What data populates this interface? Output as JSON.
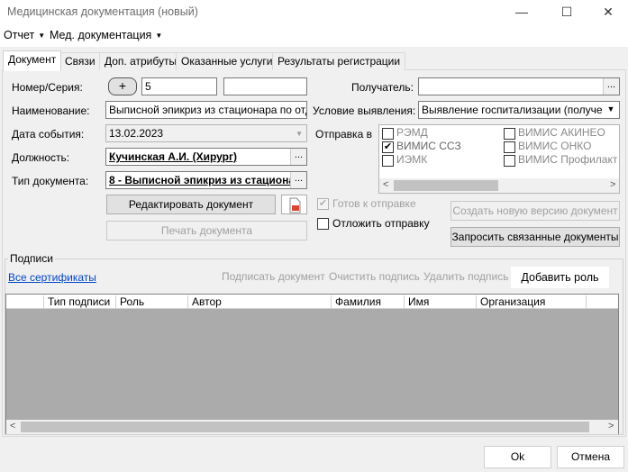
{
  "window": {
    "title": "Медицинская документация (новый)",
    "minimize": "—",
    "maximize": "☐",
    "close": "✕"
  },
  "menubar": {
    "items": [
      {
        "label": "Отчет",
        "arrow": "▼"
      },
      {
        "label": "Мед. документация",
        "arrow": "▼"
      }
    ]
  },
  "tabs": [
    "Документ",
    "Связи",
    "Доп. атрибуты",
    "Оказанные услуги",
    "Результаты регистрации"
  ],
  "form": {
    "number_label": "Номер/Серия:",
    "plus_btn": "+",
    "number_value": "5",
    "series_value": "",
    "name_label": "Наименование:",
    "name_value": "Выписной эпикриз из стационара по отдел",
    "date_label": "Дата события:",
    "date_value": "13.02.2023",
    "position_label": "Должность:",
    "position_value": "Кучинская А.И. (Хирург)",
    "doctype_label": "Тип документа:",
    "doctype_value": "8 - Выписной эпикриз из стациона",
    "ellipsis": "...",
    "dropdown_arrow": "▼",
    "edit_btn": "Редактировать документ",
    "print_btn": "Печать документа",
    "recipient_label": "Получатель:",
    "recipient_value": "",
    "condition_label": "Условие выявления:",
    "condition_value": "Выявление госпитализации (получение",
    "send_label": "Отправка в",
    "send_targets": [
      {
        "label": "РЭМД",
        "checked": false
      },
      {
        "label": "ВИМИС АКИНЕО",
        "checked": false
      },
      {
        "label": "ВИМИС ССЗ",
        "checked": true
      },
      {
        "label": "ВИМИС ОНКО",
        "checked": false
      },
      {
        "label": "ИЭМК",
        "checked": false
      },
      {
        "label": "ВИМИС Профилактик",
        "checked": false
      }
    ],
    "ready_label": "Готов к отправке",
    "postpone_label": "Отложить отправку",
    "create_version_btn": "Создать новую версию документ",
    "request_related_btn": "Запросить связанные документы",
    "check_mark": "✔"
  },
  "signatures": {
    "group_label": "Подписи",
    "all_certs_link": "Все сертификаты",
    "sign_doc": "Подписать документ",
    "clear_sign": "Очистить подпись",
    "delete_sign": "Удалить подпись",
    "add_role": "Добавить роль",
    "columns": [
      "Тип подписи",
      "Роль",
      "Автор",
      "Фамилия",
      "Имя",
      "Организация"
    ]
  },
  "footer": {
    "ok": "Ok",
    "cancel": "Отмена"
  },
  "scroll": {
    "left": "<",
    "right": ">"
  }
}
